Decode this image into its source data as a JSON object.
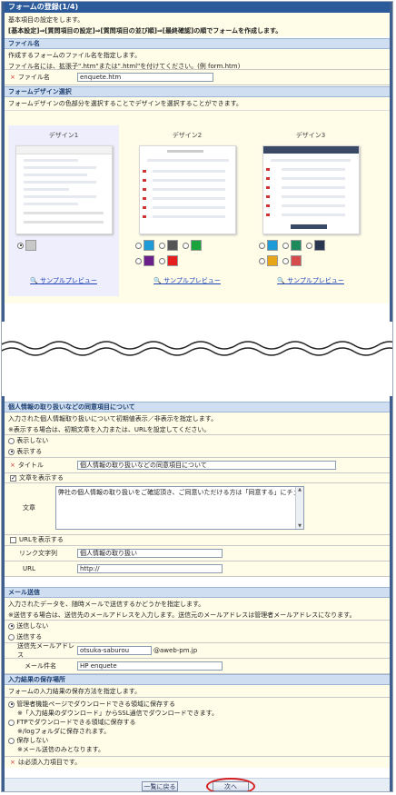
{
  "header": {
    "title": "フォームの登録(1/4)"
  },
  "basic": {
    "line1": "基本項目の設定をします。",
    "line2": "[基本設定]⇒[質問項目の設定]⇒[質問項目の並び順]⇒[最終確認]の順でフォームを作成します。"
  },
  "filename": {
    "heading": "ファイル名",
    "desc1": "作成するフォームのファイル名を指定します。",
    "desc2": "ファイル名には、拡張子\".htm\"または\".html\"を付けてください。(例 form.htm)",
    "label": "ファイル名",
    "value": "enquete.htm"
  },
  "design": {
    "heading": "フォームデザイン選択",
    "desc": "フォームデザインの色部分を選択することでデザインを選択することができます。",
    "cards": [
      {
        "title": "デザイン1",
        "preview": "サンプルプレビュー"
      },
      {
        "title": "デザイン2",
        "preview": "サンプルプレビュー"
      },
      {
        "title": "デザイン3",
        "preview": "サンプルプレビュー"
      }
    ],
    "colors": {
      "d1": [
        "#c8c8c8"
      ],
      "d2": [
        "#1e9ad6",
        "#555555",
        "#19a33a",
        "#6c1f8b",
        "#e61e1e"
      ],
      "d3": [
        "#1e9ad6",
        "#1d8a5c",
        "#2a3550",
        "#e6a617",
        "#d64b4b"
      ]
    }
  },
  "privacy": {
    "heading": "個人情報の取り扱いなどの同意項目について",
    "desc1": "入力された個人情報取り扱いについて初期値表示／非表示を指定します。",
    "desc2": "※表示する場合は、初期文章を入力または、URLを設定してください。",
    "opt_hide": "表示しない",
    "opt_show": "表示する",
    "title_label": "タイトル",
    "title_value": "個人情報の取り扱いなどの同意項目について",
    "show_text_label": "文章を表示する",
    "text_label": "文章",
    "text_value": "弊社の個人情報の取り扱いをご確認頂き、ご同意いただける方は「同意する」にチェックを入れて、確",
    "url_check_label": "URLを表示する",
    "link_label": "リンク文字列",
    "link_value": "個人情報の取り扱い",
    "url_label": "URL",
    "url_value": "http://"
  },
  "mail": {
    "heading": "メール送信",
    "desc1": "入力されたデータを、随時メールで送信するかどうかを指定します。",
    "desc2": "※送信する場合は、送信先のメールアドレスを入力します。送信元のメールアドレスは管理者メールアドレスになります。",
    "opt_no": "送信しない",
    "opt_yes": "送信する",
    "to_label": "送信先メールアドレス",
    "to_user": "otsuka-saburou",
    "to_domain": "@aweb-pm.jp",
    "subject_label": "メール件名",
    "subject_value": "HP enquete"
  },
  "storage": {
    "heading": "入力結果の保存場所",
    "desc": "フォームの入力結果の保存方法を指定します。",
    "opt1": "管理者機能ページでダウンロードできる領域に保存する",
    "opt1_note": "※「入力結果のダウンロード」からSSL通信でダウンロードできます。",
    "opt2": "FTPでダウンロードできる領域に保存する",
    "opt2_note": "※/logフォルダに保存されます。",
    "opt3": "保存しない",
    "opt3_note": "※メール送信のみとなります。"
  },
  "footer": {
    "required_note": "は必須入力項目です。",
    "back_label": "一覧に戻る",
    "next_label": "次へ"
  }
}
